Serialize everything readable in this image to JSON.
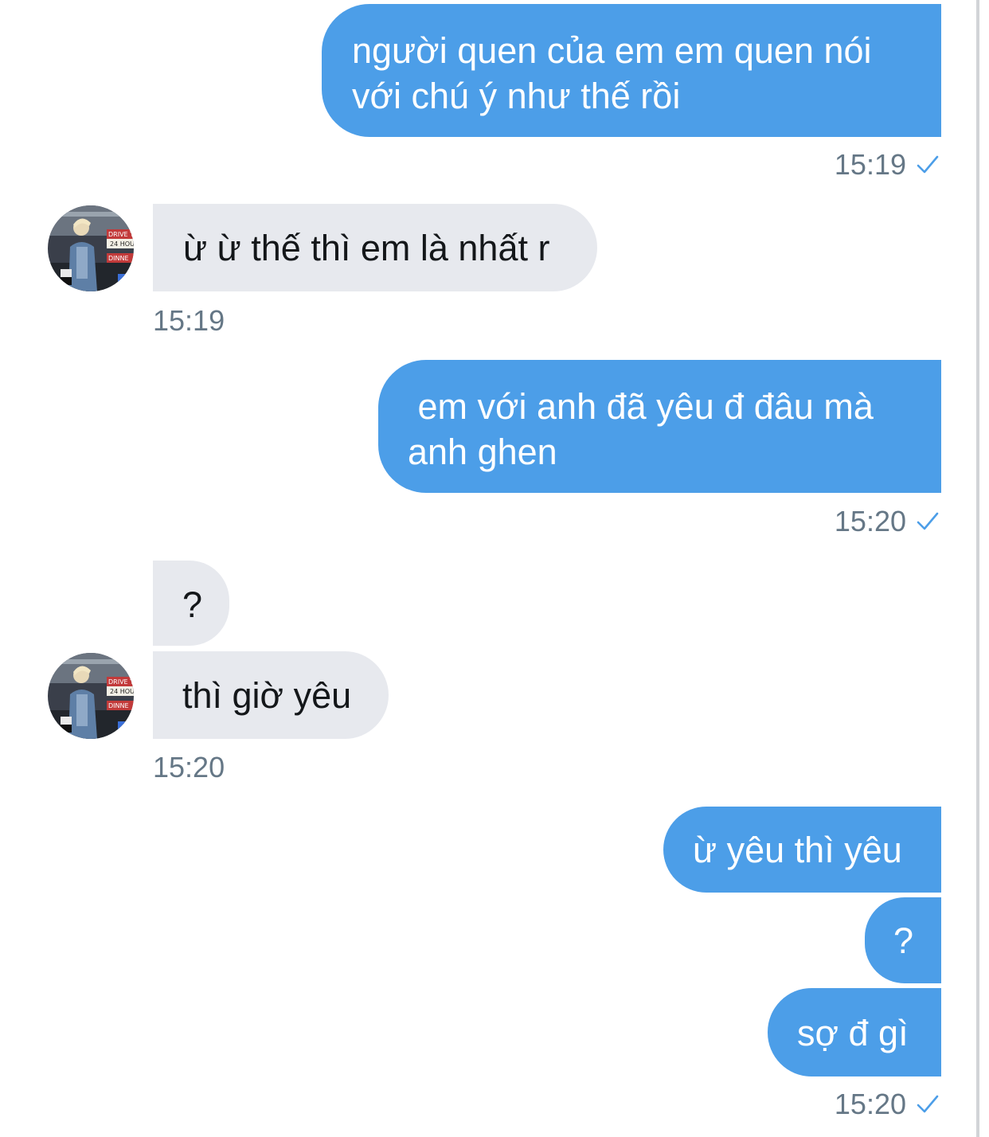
{
  "conversation": {
    "accent_color": "#4c9ee8",
    "messages": [
      {
        "id": "m1",
        "direction": "outgoing",
        "lines": [
          "người quen của em em quen nói",
          "với chú ý như thế rồi"
        ]
      },
      {
        "id": "t1",
        "time": "15:19",
        "status_icon": "read-check-icon"
      },
      {
        "id": "m2",
        "direction": "incoming",
        "text": "ừ ừ thế thì em là nhất r"
      },
      {
        "id": "t2",
        "time": "15:19"
      },
      {
        "id": "m3",
        "direction": "outgoing",
        "lines": [
          " em với anh đã yêu đ đâu mà",
          "anh ghen"
        ]
      },
      {
        "id": "t3",
        "time": "15:20",
        "status_icon": "read-check-icon"
      },
      {
        "id": "m4",
        "direction": "incoming",
        "text": "?"
      },
      {
        "id": "m5",
        "direction": "incoming",
        "text": "thì giờ yêu"
      },
      {
        "id": "t4",
        "time": "15:20"
      },
      {
        "id": "m6",
        "direction": "outgoing",
        "text": "ừ yêu thì yêu"
      },
      {
        "id": "m7",
        "direction": "outgoing",
        "text": "?"
      },
      {
        "id": "m8",
        "direction": "outgoing",
        "text": "sợ đ gì"
      },
      {
        "id": "t5",
        "time": "15:20",
        "status_icon": "read-check-icon"
      }
    ]
  },
  "avatar_sign": {
    "line1": "DRIVE T",
    "line2": "24 HOU",
    "line3": "DINNE"
  }
}
